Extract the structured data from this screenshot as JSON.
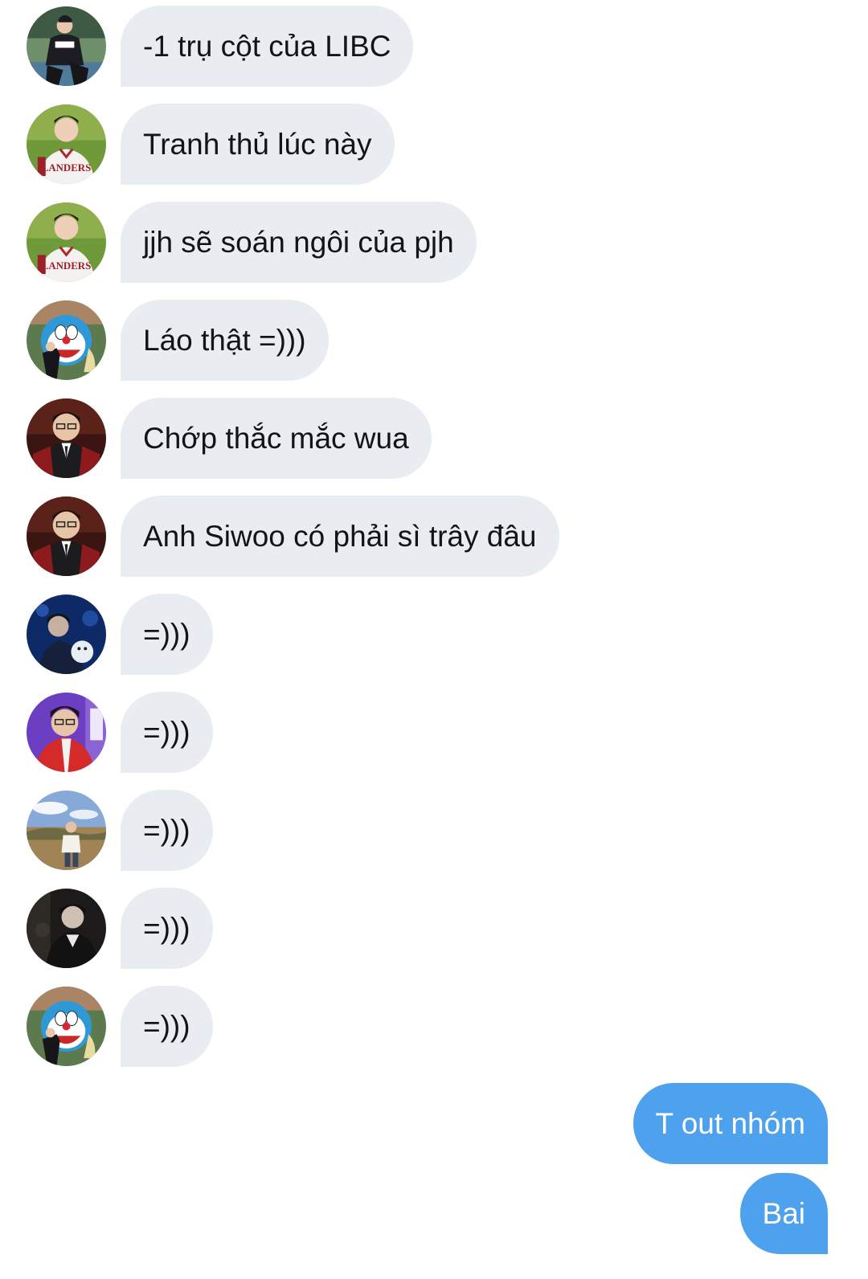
{
  "thread": {
    "incoming": [
      {
        "text": "-1 trụ cột của LIBC",
        "avatar_icon": "avatar-fan-squatting-icon"
      },
      {
        "text": "Tranh thủ lúc này",
        "avatar_icon": "avatar-baseball-jersey-icon"
      },
      {
        "text": "jjh sẽ soán ngôi của pjh",
        "avatar_icon": "avatar-baseball-jersey-icon"
      },
      {
        "text": "Láo thật =)))",
        "avatar_icon": "avatar-doraemon-icon"
      },
      {
        "text": "Chớp thắc mắc wua",
        "avatar_icon": "avatar-suit-smiling-icon"
      },
      {
        "text": "Anh Siwoo có phải sì trây đâu",
        "avatar_icon": "avatar-suit-smiling-icon"
      },
      {
        "text": "=)))",
        "avatar_icon": "avatar-blue-night-icon"
      },
      {
        "text": "=)))",
        "avatar_icon": "avatar-purple-jacket-icon"
      },
      {
        "text": "=)))",
        "avatar_icon": "avatar-field-sky-icon"
      },
      {
        "text": "=)))",
        "avatar_icon": "avatar-dark-photo-icon"
      },
      {
        "text": "=)))",
        "avatar_icon": "avatar-doraemon-icon"
      }
    ],
    "outgoing": [
      {
        "text": "T out nhóm"
      },
      {
        "text": "Bai"
      }
    ]
  },
  "colors": {
    "incoming_bubble": "#e9ecf0",
    "outgoing_bubble": "#4ea1ec",
    "incoming_text": "#111418",
    "outgoing_text": "#ffffff",
    "background": "#ffffff"
  }
}
